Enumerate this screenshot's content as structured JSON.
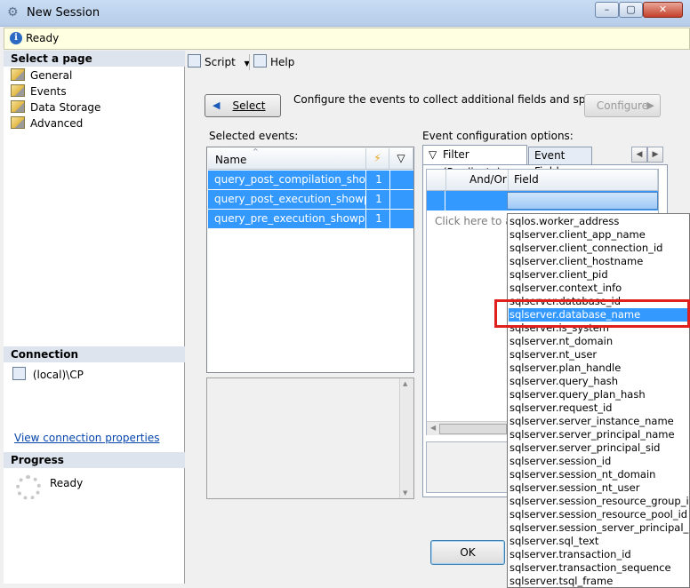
{
  "window": {
    "title": "New Session",
    "min_label": "–",
    "max_label": "▢",
    "close_label": "✕"
  },
  "status": {
    "text": "Ready",
    "icon": "info-icon"
  },
  "left": {
    "select_page_header": "Select a page",
    "pages": [
      "General",
      "Events",
      "Data Storage",
      "Advanced"
    ],
    "connection_header": "Connection",
    "connection_server": "(local)\\CP",
    "view_connection_link": "View connection properties",
    "progress_header": "Progress",
    "progress_status": "Ready"
  },
  "toolbar": {
    "script_label": "Script",
    "help_label": "Help"
  },
  "events": {
    "select_button": "Select",
    "configure_text": "Configure the events to collect additional fields and specify",
    "configure_button": "Configure",
    "selected_events_label": "Selected events:",
    "name_header": "Name",
    "rows": [
      {
        "name": "query_post_compilation_show...",
        "count": "1"
      },
      {
        "name": "query_post_execution_showplan",
        "count": "1"
      },
      {
        "name": "query_pre_execution_showplan",
        "count": "1"
      }
    ]
  },
  "config": {
    "label": "Event configuration options:",
    "tab_filter": "Filter (Predicate)",
    "tab_fields": "Event Fields",
    "col_andor": "And/Or",
    "col_field": "Field",
    "click_add": "Click here to add"
  },
  "field_list": {
    "selected_index": 7,
    "items": [
      "sqlos.worker_address",
      "sqlserver.client_app_name",
      "sqlserver.client_connection_id",
      "sqlserver.client_hostname",
      "sqlserver.client_pid",
      "sqlserver.context_info",
      "sqlserver.database_id",
      "sqlserver.database_name",
      "sqlserver.is_system",
      "sqlserver.nt_domain",
      "sqlserver.nt_user",
      "sqlserver.plan_handle",
      "sqlserver.query_hash",
      "sqlserver.query_plan_hash",
      "sqlserver.request_id",
      "sqlserver.server_instance_name",
      "sqlserver.server_principal_name",
      "sqlserver.server_principal_sid",
      "sqlserver.session_id",
      "sqlserver.session_nt_domain",
      "sqlserver.session_nt_user",
      "sqlserver.session_resource_group_id",
      "sqlserver.session_resource_pool_id",
      "sqlserver.session_server_principal_name",
      "sqlserver.sql_text",
      "sqlserver.transaction_id",
      "sqlserver.transaction_sequence",
      "sqlserver.tsql_frame"
    ]
  },
  "buttons": {
    "ok": "OK"
  },
  "colors": {
    "selection": "#3399ff",
    "highlight_box": "#e0201c"
  }
}
